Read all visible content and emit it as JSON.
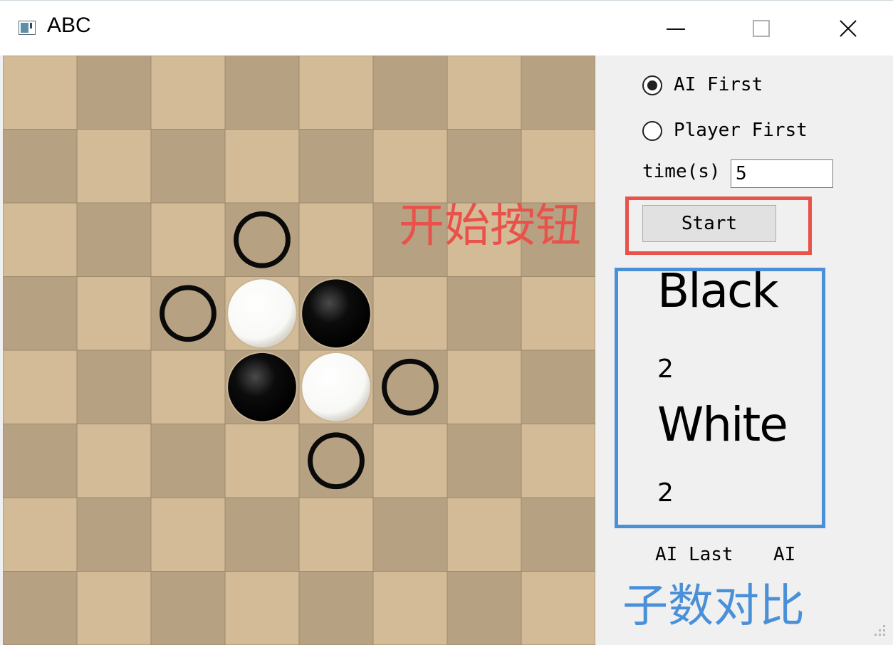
{
  "window": {
    "title": "ABC",
    "icons": {
      "app": "app-window-icon",
      "minimize": "minimize-icon",
      "maximize": "maximize-icon",
      "close": "close-icon"
    }
  },
  "board": {
    "size": 8,
    "colors": {
      "light": "#d2bb96",
      "dark": "#b6a283",
      "black": "#0c0c0c",
      "white": "#f8f8f6"
    },
    "stones": [
      {
        "row": 3,
        "col": 3,
        "color": "white"
      },
      {
        "row": 3,
        "col": 4,
        "color": "black"
      },
      {
        "row": 4,
        "col": 3,
        "color": "black"
      },
      {
        "row": 4,
        "col": 4,
        "color": "white"
      }
    ],
    "hints": [
      {
        "row": 2,
        "col": 3
      },
      {
        "row": 3,
        "col": 2
      },
      {
        "row": 4,
        "col": 5
      },
      {
        "row": 5,
        "col": 4
      }
    ]
  },
  "controls": {
    "ai_first": "AI First",
    "player_first": "Player First",
    "selected": "ai_first",
    "time_label": "time(s)",
    "time_value": "5",
    "start_label": "Start"
  },
  "score": {
    "black_label": "Black",
    "black_count": "2",
    "white_label": "White",
    "white_count": "2"
  },
  "status": {
    "last_label": "AI Last",
    "last_value": "AI"
  },
  "annotations": {
    "start_note": "开始按钮",
    "score_note": "子数对比",
    "start_color": "#e8524a",
    "score_color": "#4a90d9"
  }
}
